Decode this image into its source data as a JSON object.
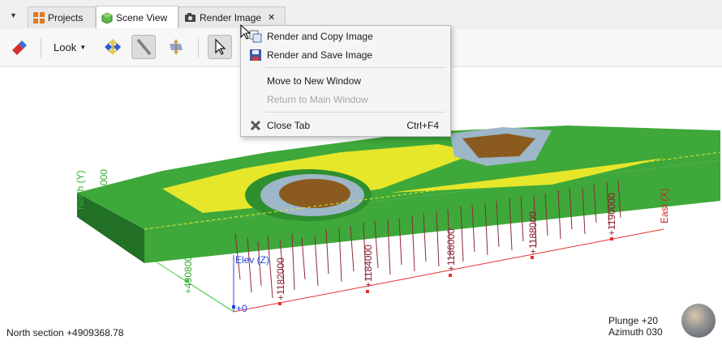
{
  "tabs": [
    {
      "label": "Projects",
      "icon": "projects-grid-icon"
    },
    {
      "label": "Scene View",
      "icon": "cube-icon"
    },
    {
      "label": "Render Image",
      "icon": "camera-icon",
      "close": "✕"
    }
  ],
  "toolbar": {
    "look_label": "Look",
    "items": [
      "eraser-icon",
      "look-dropdown",
      "orbit-icon",
      "slice-icon",
      "move-slice-icon",
      "select-pointer-icon"
    ]
  },
  "context_menu": {
    "items": [
      {
        "label": "Render and Copy Image",
        "mnemonic": "R",
        "icon": "copy-image-icon",
        "enabled": true
      },
      {
        "label": "Render and Save Image",
        "mnemonic": "S",
        "icon": "save-icon",
        "enabled": true
      },
      {
        "label": "Move to New Window",
        "mnemonic": "W",
        "enabled": true
      },
      {
        "label": "Return to Main Window",
        "mnemonic": "M",
        "enabled": false
      },
      {
        "label": "Close Tab",
        "mnemonic": "C",
        "icon": "close-tab-icon",
        "shortcut": "Ctrl+F4",
        "enabled": true
      }
    ]
  },
  "scene": {
    "north_axis_label": "North (Y)",
    "north_tick": "000",
    "north_tick_2": "+4908000",
    "elev_label": "Elev (Z)",
    "elev_tick": "+0",
    "east_axis_label": "East (X)",
    "east_ticks": [
      "+1182000",
      "+1184000",
      "+1186000",
      "+1188000",
      "+1190000"
    ],
    "colors": {
      "green": "#3ea83a",
      "yellow": "#e6e62a",
      "brown": "#8a5a1e",
      "blue_gray": "#9db6c8",
      "red_axis": "#e53030",
      "green_axis": "#44cc44",
      "blue_axis": "#2244dd"
    }
  },
  "status": {
    "section": "North section +4909368.78",
    "plunge": "Plunge +20",
    "azimuth": "Azimuth 030"
  }
}
